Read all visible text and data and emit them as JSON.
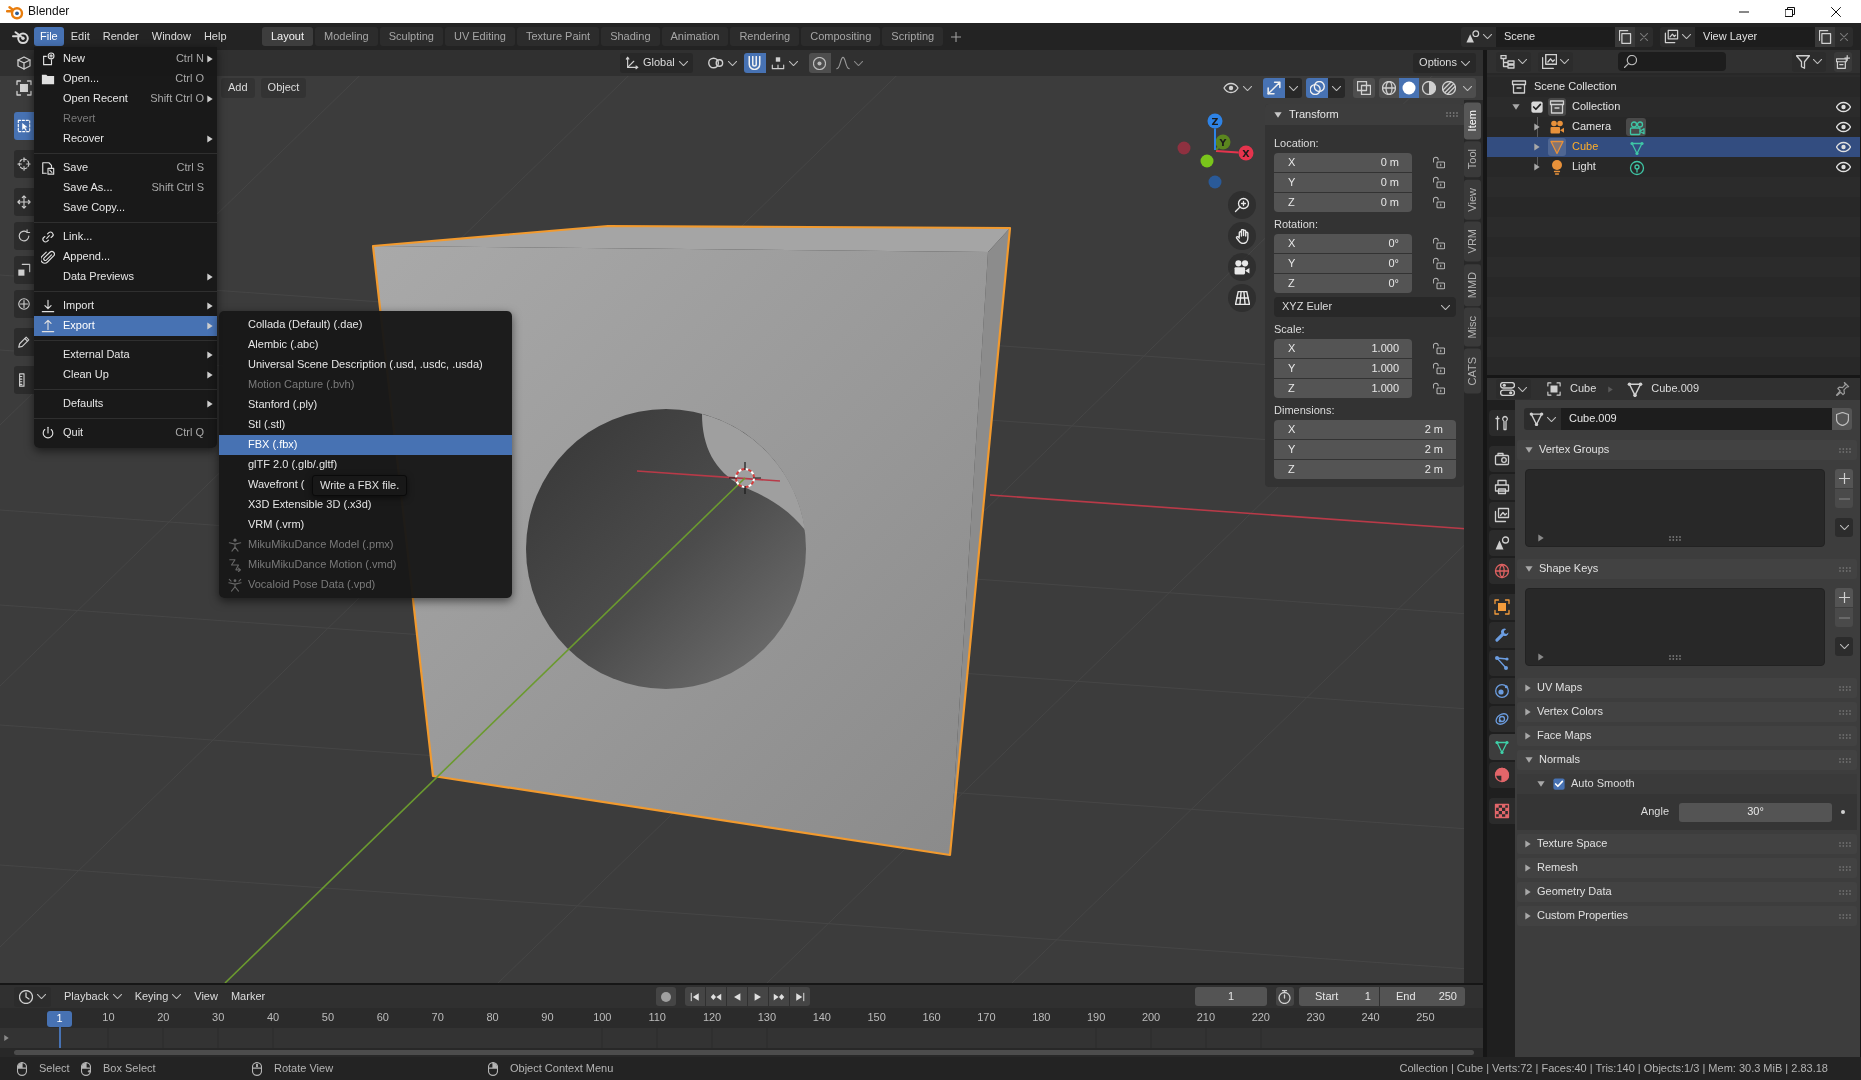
{
  "window": {
    "title": "Blender"
  },
  "top_bar": {
    "menus": [
      {
        "label": "File",
        "selected": true
      },
      {
        "label": "Edit",
        "selected": false
      },
      {
        "label": "Render",
        "selected": false
      },
      {
        "label": "Window",
        "selected": false
      },
      {
        "label": "Help",
        "selected": false
      }
    ],
    "workspaces": [
      {
        "label": "Layout",
        "selected": true
      },
      {
        "label": "Modeling",
        "selected": false
      },
      {
        "label": "Sculpting",
        "selected": false
      },
      {
        "label": "UV Editing",
        "selected": false
      },
      {
        "label": "Texture Paint",
        "selected": false
      },
      {
        "label": "Shading",
        "selected": false
      },
      {
        "label": "Animation",
        "selected": false
      },
      {
        "label": "Rendering",
        "selected": false
      },
      {
        "label": "Compositing",
        "selected": false
      },
      {
        "label": "Scripting",
        "selected": false
      }
    ],
    "scene": "Scene",
    "view_layer": "View Layer"
  },
  "file_menu": {
    "groups": [
      [
        {
          "label": "New",
          "shortcut": "Ctrl N",
          "submenu": true,
          "disabled": false,
          "selected": false
        },
        {
          "label": "Open...",
          "shortcut": "Ctrl O",
          "submenu": false,
          "disabled": false,
          "selected": false
        },
        {
          "label": "Open Recent",
          "shortcut": "Shift Ctrl O",
          "submenu": true,
          "disabled": false,
          "selected": false
        },
        {
          "label": "Revert",
          "submenu": false,
          "disabled": true,
          "selected": false
        },
        {
          "label": "Recover",
          "submenu": true,
          "disabled": false,
          "selected": false
        }
      ],
      [
        {
          "label": "Save",
          "shortcut": "Ctrl S",
          "submenu": false,
          "disabled": false,
          "selected": false
        },
        {
          "label": "Save As...",
          "shortcut": "Shift Ctrl S",
          "submenu": false,
          "disabled": false,
          "selected": false
        },
        {
          "label": "Save Copy...",
          "submenu": false,
          "disabled": false,
          "selected": false
        }
      ],
      [
        {
          "label": "Link...",
          "submenu": false,
          "disabled": false,
          "selected": false
        },
        {
          "label": "Append...",
          "submenu": false,
          "disabled": false,
          "selected": false
        },
        {
          "label": "Data Previews",
          "submenu": true,
          "disabled": false,
          "selected": false
        }
      ],
      [
        {
          "label": "Import",
          "submenu": true,
          "disabled": false,
          "selected": false
        },
        {
          "label": "Export",
          "submenu": true,
          "disabled": false,
          "selected": true
        }
      ],
      [
        {
          "label": "External Data",
          "submenu": true,
          "disabled": false,
          "selected": false
        },
        {
          "label": "Clean Up",
          "submenu": true,
          "disabled": false,
          "selected": false
        }
      ],
      [
        {
          "label": "Defaults",
          "submenu": true,
          "disabled": false,
          "selected": false
        }
      ],
      [
        {
          "label": "Quit",
          "shortcut": "Ctrl Q",
          "submenu": false,
          "disabled": false,
          "selected": false
        }
      ]
    ]
  },
  "export_menu": {
    "items": [
      {
        "label": "Collada (Default) (.dae)",
        "disabled": false,
        "selected": false
      },
      {
        "label": "Alembic (.abc)",
        "disabled": false,
        "selected": false
      },
      {
        "label": "Universal Scene Description (.usd, .usdc, .usda)",
        "disabled": false,
        "selected": false
      },
      {
        "label": "Motion Capture (.bvh)",
        "disabled": true,
        "selected": false
      },
      {
        "label": "Stanford (.ply)",
        "disabled": false,
        "selected": false
      },
      {
        "label": "Stl (.stl)",
        "disabled": false,
        "selected": false
      },
      {
        "label": "FBX (.fbx)",
        "disabled": false,
        "selected": true
      },
      {
        "label": "glTF 2.0 (.glb/.gltf)",
        "disabled": false,
        "selected": false
      },
      {
        "label": "Wavefront (",
        "disabled": false,
        "selected": false
      },
      {
        "label": "X3D Extensible 3D (.x3d)",
        "disabled": false,
        "selected": false
      },
      {
        "label": "VRM (.vrm)",
        "disabled": false,
        "selected": false
      },
      {
        "label": "MikuMikuDance Model (.pmx)",
        "disabled": true,
        "selected": false
      },
      {
        "label": "MikuMikuDance Motion (.vmd)",
        "disabled": true,
        "selected": false
      },
      {
        "label": "Vocaloid Pose Data (.vpd)",
        "disabled": true,
        "selected": false
      }
    ],
    "tooltip": "Write a FBX file."
  },
  "viewport": {
    "header": {
      "orientation": "Global",
      "snapping": true,
      "proportional_editing": false,
      "options": "Options",
      "menus": [
        "Add",
        "Object"
      ],
      "gizmos": true,
      "overlays": true,
      "xray": false,
      "shading_modes": [
        {
          "selected": false
        },
        {
          "selected": true
        },
        {
          "selected": false
        },
        {
          "selected": false
        }
      ]
    },
    "toolbar": [
      [
        {
          "selected": true
        }
      ],
      [
        {
          "selected": false
        }
      ],
      [
        {
          "selected": false
        },
        {
          "selected": false
        },
        {
          "selected": false
        },
        {
          "selected": false
        }
      ],
      [
        {
          "selected": false
        }
      ],
      [
        {
          "selected": false
        }
      ]
    ],
    "navigation_gizmo": {
      "axes": [
        "X",
        "Y",
        "Z"
      ]
    },
    "sidebar": {
      "tabs": [
        {
          "label": "Item",
          "selected": true
        },
        {
          "label": "Tool",
          "selected": false
        },
        {
          "label": "View",
          "selected": false
        },
        {
          "label": "VRM",
          "selected": false
        },
        {
          "label": "MMD",
          "selected": false
        },
        {
          "label": "Misc",
          "selected": false
        },
        {
          "label": "CATS",
          "selected": false
        }
      ],
      "transform": {
        "title": "Transform",
        "expanded": true,
        "location": {
          "label": "Location:",
          "fields": [
            {
              "axis": "X",
              "value": "0 m",
              "locked": false
            },
            {
              "axis": "Y",
              "value": "0 m",
              "locked": false
            },
            {
              "axis": "Z",
              "value": "0 m",
              "locked": false
            }
          ]
        },
        "rotation": {
          "label": "Rotation:",
          "fields": [
            {
              "axis": "X",
              "value": "0°",
              "locked": false
            },
            {
              "axis": "Y",
              "value": "0°",
              "locked": false
            },
            {
              "axis": "Z",
              "value": "0°",
              "locked": false
            }
          ]
        },
        "rotation_mode": "XYZ Euler",
        "scale": {
          "label": "Scale:",
          "fields": [
            {
              "axis": "X",
              "value": "1.000",
              "locked": false
            },
            {
              "axis": "Y",
              "value": "1.000",
              "locked": false
            },
            {
              "axis": "Z",
              "value": "1.000",
              "locked": false
            }
          ]
        },
        "dimensions": {
          "label": "Dimensions:",
          "fields": [
            {
              "axis": "X",
              "value": "2 m"
            },
            {
              "axis": "Y",
              "value": "2 m"
            },
            {
              "axis": "Z",
              "value": "2 m"
            }
          ]
        }
      }
    }
  },
  "outliner": {
    "tree": [
      {
        "label": "Scene Collection",
        "kind": "scene_collection",
        "children": [
          {
            "label": "Collection",
            "kind": "collection",
            "expanded": true,
            "checked": true,
            "icon_highlighted": true,
            "selected": false,
            "visible": true,
            "children": [
              {
                "label": "Camera",
                "kind": "camera",
                "expanded": false,
                "icon_highlighted": false,
                "data_highlighted": true,
                "selected": false,
                "visible": true
              },
              {
                "label": "Cube",
                "kind": "mesh",
                "expanded": false,
                "icon_highlighted": true,
                "data_highlighted": false,
                "selected": true,
                "visible": true
              },
              {
                "label": "Light",
                "kind": "light",
                "expanded": false,
                "icon_highlighted": false,
                "data_highlighted": false,
                "selected": false,
                "visible": true
              }
            ]
          }
        ]
      }
    ]
  },
  "properties": {
    "breadcrumb": {
      "object": "Cube",
      "data": "Cube.009"
    },
    "datablock": "Cube.009",
    "tabs": [
      [
        {
          "selected": false
        }
      ],
      [
        {
          "selected": false
        },
        {
          "selected": false
        },
        {
          "selected": false
        },
        {
          "selected": false
        },
        {
          "selected": false
        }
      ],
      [
        {
          "selected": false
        },
        {
          "selected": false
        },
        {
          "selected": false
        },
        {
          "selected": false
        },
        {
          "selected": false
        },
        {
          "selected": true
        },
        {
          "selected": false
        }
      ],
      [
        {
          "selected": false
        }
      ]
    ],
    "panels": [
      {
        "title": "Vertex Groups",
        "kind": "list",
        "expanded": true
      },
      {
        "title": "Shape Keys",
        "kind": "list",
        "expanded": true
      },
      {
        "title": "UV Maps",
        "expanded": false
      },
      {
        "title": "Vertex Colors",
        "expanded": false
      },
      {
        "title": "Face Maps",
        "expanded": false
      },
      {
        "title": "Normals",
        "kind": "normals",
        "expanded": true,
        "subpanel": {
          "title": "Auto Smooth",
          "expanded": true,
          "checked": true,
          "field_label": "Angle",
          "value": "30°"
        }
      },
      {
        "title": "Texture Space",
        "expanded": false
      },
      {
        "title": "Remesh",
        "expanded": false
      },
      {
        "title": "Geometry Data",
        "expanded": false
      },
      {
        "title": "Custom Properties",
        "expanded": false
      }
    ]
  },
  "timeline": {
    "menus": [
      {
        "label": "Playback",
        "kind": "dropdown"
      },
      {
        "label": "Keying",
        "kind": "dropdown"
      },
      {
        "label": "View",
        "kind": "menu"
      },
      {
        "label": "Marker",
        "kind": "menu"
      }
    ],
    "auto_keying": false,
    "current_frame": "1",
    "preview_range": false,
    "start": {
      "label": "Start",
      "value": "1"
    },
    "end": {
      "label": "End",
      "value": "250"
    },
    "playhead": "1",
    "ruler": [
      "10",
      "20",
      "30",
      "40",
      "50",
      "60",
      "70",
      "80",
      "90",
      "100",
      "110",
      "120",
      "130",
      "140",
      "150",
      "160",
      "170",
      "180",
      "190",
      "200",
      "210",
      "220",
      "230",
      "240",
      "250"
    ]
  },
  "status_bar": {
    "hints": [
      {
        "label": "Select",
        "kind": "left_click"
      },
      {
        "label": "Box Select",
        "kind": "left_drag"
      },
      {
        "label": "Rotate View",
        "kind": "middle_click"
      },
      {
        "label": "Object Context Menu",
        "kind": "right_click"
      }
    ],
    "stats": "Collection | Cube | Verts:72 | Faces:40 | Tris:140 | Objects:1/3 | Mem: 30.3 MiB | 2.83.18"
  }
}
